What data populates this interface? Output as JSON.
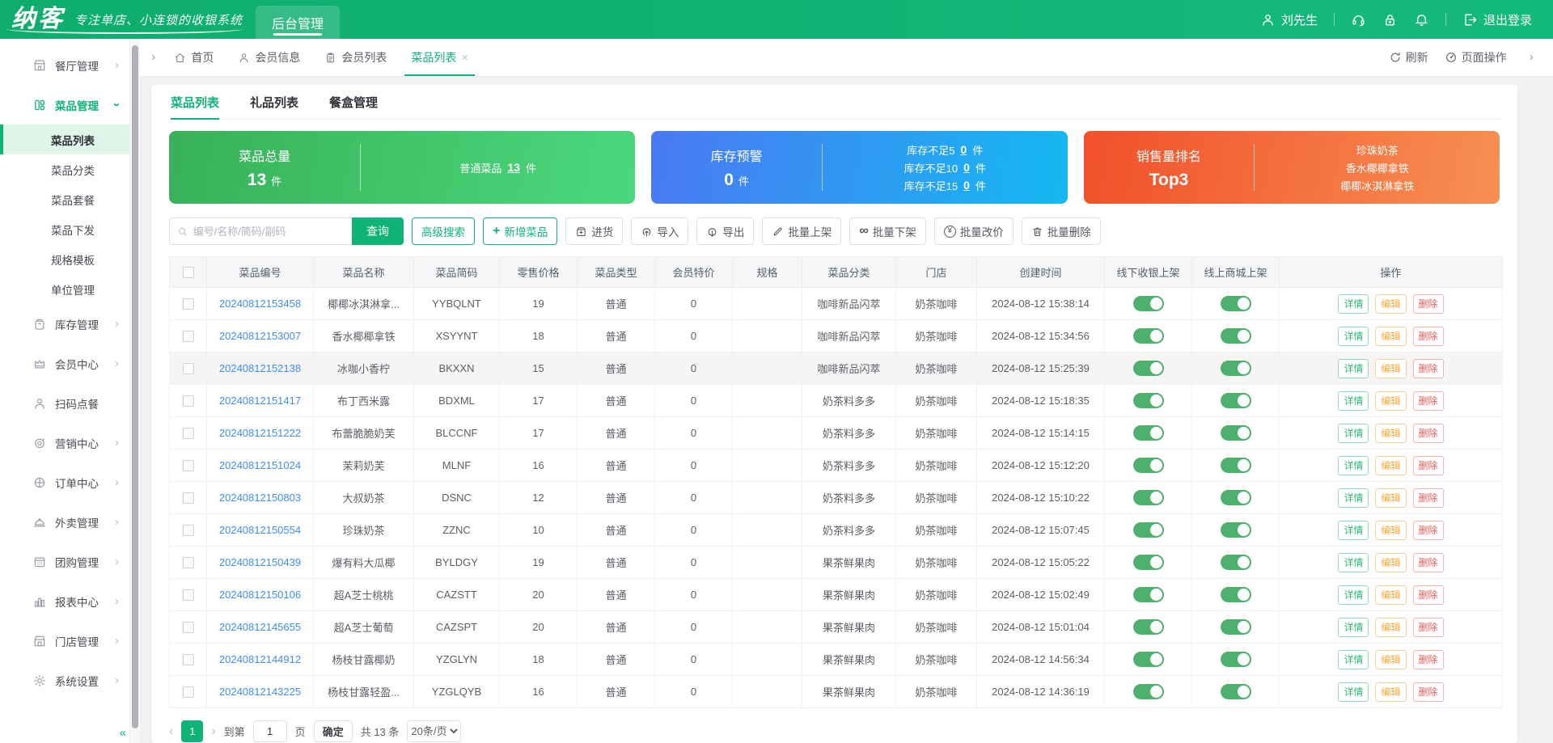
{
  "header": {
    "logo": "纳客",
    "tagline": "专注单店、小连锁的收银系统",
    "nav_tab": "后台管理",
    "user": "刘先生",
    "logout": "退出登录",
    "right_icons": [
      "headset-icon",
      "lock-icon",
      "bell-icon"
    ]
  },
  "tabbar": {
    "tabs": [
      {
        "label": "首页",
        "icon": "home-icon",
        "active": false,
        "closable": false
      },
      {
        "label": "会员信息",
        "icon": "member-info-icon",
        "active": false,
        "closable": false
      },
      {
        "label": "会员列表",
        "icon": "member-list-icon",
        "active": false,
        "closable": false
      },
      {
        "label": "菜品列表",
        "icon": "",
        "active": true,
        "closable": true
      }
    ],
    "refresh": "刷新",
    "page_ops": "页面操作"
  },
  "sidebar": {
    "items": [
      {
        "label": "餐厅管理",
        "icon": "restaurant-icon",
        "has_children": true,
        "active": false
      },
      {
        "label": "菜品管理",
        "icon": "dish-icon",
        "has_children": true,
        "active": true,
        "expanded": true,
        "children": [
          "菜品列表",
          "菜品分类",
          "菜品套餐",
          "菜品下发",
          "规格模板",
          "单位管理"
        ],
        "selected_child": "菜品列表"
      },
      {
        "label": "库存管理",
        "icon": "inventory-icon",
        "has_children": true,
        "active": false
      },
      {
        "label": "会员中心",
        "icon": "member-icon",
        "has_children": true,
        "active": false
      },
      {
        "label": "扫码点餐",
        "icon": "scan-icon",
        "has_children": false,
        "active": false
      },
      {
        "label": "营销中心",
        "icon": "marketing-icon",
        "has_children": true,
        "active": false
      },
      {
        "label": "订单中心",
        "icon": "order-icon",
        "has_children": true,
        "active": false
      },
      {
        "label": "外卖管理",
        "icon": "takeout-icon",
        "has_children": true,
        "active": false
      },
      {
        "label": "团购管理",
        "icon": "groupbuy-icon",
        "has_children": true,
        "active": false
      },
      {
        "label": "报表中心",
        "icon": "report-icon",
        "has_children": true,
        "active": false
      },
      {
        "label": "门店管理",
        "icon": "store-icon",
        "has_children": true,
        "active": false
      },
      {
        "label": "系统设置",
        "icon": "settings-icon",
        "has_children": true,
        "active": false
      }
    ]
  },
  "content": {
    "tabs": [
      "菜品列表",
      "礼品列表",
      "餐盒管理"
    ],
    "cards": {
      "total": {
        "title": "菜品总量",
        "value": "13",
        "unit": "件",
        "right_label": "普通菜品",
        "right_value": "13",
        "right_unit": "件"
      },
      "stock": {
        "title": "库存预警",
        "value": "0",
        "unit": "件",
        "rows": [
          {
            "label": "库存不足5",
            "value": "0",
            "unit": "件"
          },
          {
            "label": "库存不足10",
            "value": "0",
            "unit": "件"
          },
          {
            "label": "库存不足15",
            "value": "0",
            "unit": "件"
          }
        ]
      },
      "sales": {
        "title": "销售量排名",
        "value": "Top3",
        "items": [
          "珍珠奶茶",
          "香水椰椰拿铁",
          "椰椰冰淇淋拿铁"
        ]
      }
    },
    "toolbar": {
      "search_placeholder": "编号/名称/简码/副码",
      "search_button": "查询",
      "buttons": [
        {
          "label": "高级搜索",
          "style": "green-outline",
          "icon": ""
        },
        {
          "label": "新增菜品",
          "style": "green-outline",
          "icon": "plus-icon"
        },
        {
          "label": "进货",
          "style": "default",
          "icon": "package-icon"
        },
        {
          "label": "导入",
          "style": "default",
          "icon": "upload-icon"
        },
        {
          "label": "导出",
          "style": "default",
          "icon": "download-icon"
        },
        {
          "label": "批量上架",
          "style": "default",
          "icon": "pen-icon"
        },
        {
          "label": "批量下架",
          "style": "default",
          "icon": "infinity-icon"
        },
        {
          "label": "批量改价",
          "style": "default",
          "icon": "yuan-icon"
        },
        {
          "label": "批量删除",
          "style": "default",
          "icon": "trash-icon"
        }
      ]
    },
    "table": {
      "columns": [
        "",
        "菜品编号",
        "菜品名称",
        "菜品简码",
        "零售价格",
        "菜品类型",
        "会员特价",
        "规格",
        "菜品分类",
        "门店",
        "创建时间",
        "线下收银上架",
        "线上商城上架",
        "操作"
      ],
      "actions": [
        "详情",
        "编辑",
        "删除"
      ],
      "rows": [
        {
          "code": "20240812153458",
          "name": "椰椰冰淇淋拿...",
          "short_code": "YYBQLNT",
          "price": "19",
          "type": "普通",
          "member_price": "0",
          "spec": "",
          "category": "咖啡新品闪萃",
          "store": "奶茶咖啡",
          "created": "2024-08-12 15:38:14",
          "offline_pos": true,
          "online_mall": true,
          "highlight": false
        },
        {
          "code": "20240812153007",
          "name": "香水椰椰拿铁",
          "short_code": "XSYYNT",
          "price": "18",
          "type": "普通",
          "member_price": "0",
          "spec": "",
          "category": "咖啡新品闪萃",
          "store": "奶茶咖啡",
          "created": "2024-08-12 15:34:56",
          "offline_pos": true,
          "online_mall": true,
          "highlight": false
        },
        {
          "code": "20240812152138",
          "name": "冰咖小香柠",
          "short_code": "BKXXN",
          "price": "15",
          "type": "普通",
          "member_price": "0",
          "spec": "",
          "category": "咖啡新品闪萃",
          "store": "奶茶咖啡",
          "created": "2024-08-12 15:25:39",
          "offline_pos": true,
          "online_mall": true,
          "highlight": true
        },
        {
          "code": "20240812151417",
          "name": "布丁西米露",
          "short_code": "BDXML",
          "price": "17",
          "type": "普通",
          "member_price": "0",
          "spec": "",
          "category": "奶茶料多多",
          "store": "奶茶咖啡",
          "created": "2024-08-12 15:18:35",
          "offline_pos": true,
          "online_mall": true,
          "highlight": false
        },
        {
          "code": "20240812151222",
          "name": "布蕾脆脆奶芙",
          "short_code": "BLCCNF",
          "price": "17",
          "type": "普通",
          "member_price": "0",
          "spec": "",
          "category": "奶茶料多多",
          "store": "奶茶咖啡",
          "created": "2024-08-12 15:14:15",
          "offline_pos": true,
          "online_mall": true,
          "highlight": false
        },
        {
          "code": "20240812151024",
          "name": "茉莉奶芙",
          "short_code": "MLNF",
          "price": "16",
          "type": "普通",
          "member_price": "0",
          "spec": "",
          "category": "奶茶料多多",
          "store": "奶茶咖啡",
          "created": "2024-08-12 15:12:20",
          "offline_pos": true,
          "online_mall": true,
          "highlight": false
        },
        {
          "code": "20240812150803",
          "name": "大叔奶茶",
          "short_code": "DSNC",
          "price": "12",
          "type": "普通",
          "member_price": "0",
          "spec": "",
          "category": "奶茶料多多",
          "store": "奶茶咖啡",
          "created": "2024-08-12 15:10:22",
          "offline_pos": true,
          "online_mall": true,
          "highlight": false
        },
        {
          "code": "20240812150554",
          "name": "珍珠奶茶",
          "short_code": "ZZNC",
          "price": "10",
          "type": "普通",
          "member_price": "0",
          "spec": "",
          "category": "奶茶料多多",
          "store": "奶茶咖啡",
          "created": "2024-08-12 15:07:45",
          "offline_pos": true,
          "online_mall": true,
          "highlight": false
        },
        {
          "code": "20240812150439",
          "name": "爆有料大瓜椰",
          "short_code": "BYLDGY",
          "price": "19",
          "type": "普通",
          "member_price": "0",
          "spec": "",
          "category": "果茶鲜果肉",
          "store": "奶茶咖啡",
          "created": "2024-08-12 15:05:22",
          "offline_pos": true,
          "online_mall": true,
          "highlight": false
        },
        {
          "code": "20240812150106",
          "name": "超A芝士桃桃",
          "short_code": "CAZSTT",
          "price": "20",
          "type": "普通",
          "member_price": "0",
          "spec": "",
          "category": "果茶鲜果肉",
          "store": "奶茶咖啡",
          "created": "2024-08-12 15:02:49",
          "offline_pos": true,
          "online_mall": true,
          "highlight": false
        },
        {
          "code": "20240812145655",
          "name": "超A芝士葡萄",
          "short_code": "CAZSPT",
          "price": "20",
          "type": "普通",
          "member_price": "0",
          "spec": "",
          "category": "果茶鲜果肉",
          "store": "奶茶咖啡",
          "created": "2024-08-12 15:01:04",
          "offline_pos": true,
          "online_mall": true,
          "highlight": false
        },
        {
          "code": "20240812144912",
          "name": "杨枝甘露椰奶",
          "short_code": "YZGLYN",
          "price": "18",
          "type": "普通",
          "member_price": "0",
          "spec": "",
          "category": "果茶鲜果肉",
          "store": "奶茶咖啡",
          "created": "2024-08-12 14:56:34",
          "offline_pos": true,
          "online_mall": true,
          "highlight": false
        },
        {
          "code": "20240812143225",
          "name": "杨枝甘露轻盈...",
          "short_code": "YZGLQYB",
          "price": "16",
          "type": "普通",
          "member_price": "0",
          "spec": "",
          "category": "果茶鲜果肉",
          "store": "奶茶咖啡",
          "created": "2024-08-12 14:36:19",
          "offline_pos": true,
          "online_mall": true,
          "highlight": false
        }
      ]
    },
    "pagination": {
      "current_page": "1",
      "goto_label": "到第",
      "goto_value": "1",
      "page_unit": "页",
      "confirm": "确定",
      "total": "共 13 条",
      "page_size": "20条/页"
    }
  },
  "glyphs": {
    "close": "×",
    "chev_left": "‹",
    "chev_right": "›",
    "collapse": "«",
    "infinity": "∞",
    "yuan": "¥",
    "plus": "+"
  },
  "colors": {
    "primary_green": "#10b377",
    "header_green_from": "#0ead6e",
    "header_green_to": "#14ba7c",
    "card_green_from": "#38b159",
    "card_green_to": "#4bd87d",
    "card_blue_from": "#4b79f3",
    "card_blue_to": "#14b9f1",
    "card_orange_from": "#f1502b",
    "card_orange_to": "#f79052",
    "link_blue": "#3d8df5",
    "toggle_on": "#4db06e",
    "detail_green": "#2fb876",
    "edit_orange": "#f6a935",
    "delete_red": "#f35d5d"
  }
}
